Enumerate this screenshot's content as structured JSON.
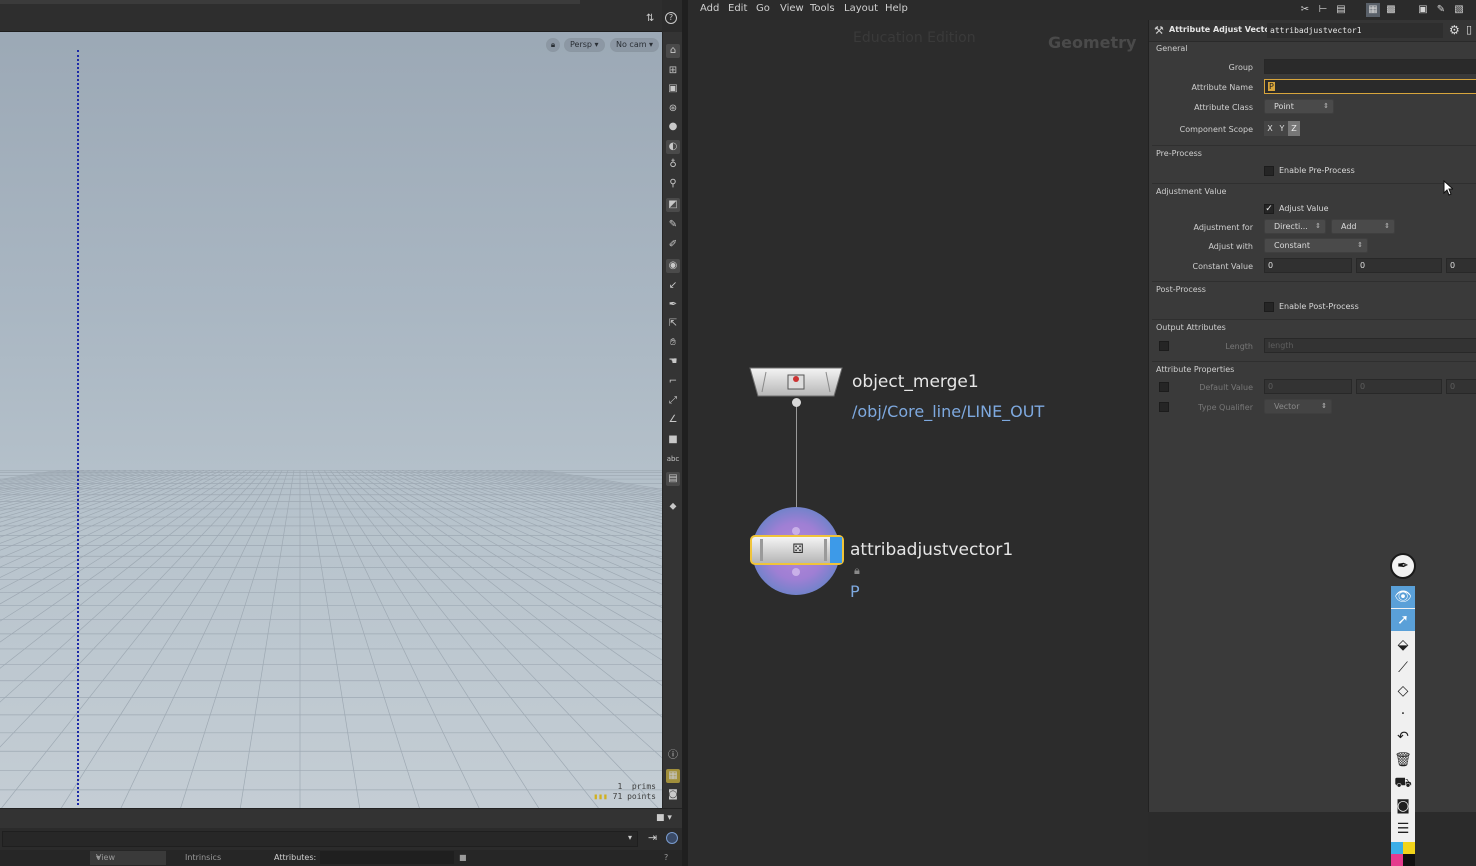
{
  "viewport": {
    "persp_label": "Persp",
    "cam_label": "No cam",
    "stats": {
      "prims_count": "1",
      "prims_label": "prims",
      "points_count": "71",
      "points_label": "points"
    }
  },
  "bottom_bar": {
    "view_tab": "View",
    "intrinsics_tab": "Intrinsics",
    "attributes_label": "Attributes:"
  },
  "menubar": {
    "items": [
      "Add",
      "Edit",
      "Go",
      "View",
      "Tools",
      "Layout",
      "Help"
    ]
  },
  "network": {
    "watermark_edition": "Education Edition",
    "context_label": "Geometry",
    "nodes": [
      {
        "name": "object_merge1",
        "subtitle": "/obj/Core_line/LINE_OUT"
      },
      {
        "name": "attribadjustvector1",
        "subtitle": "P"
      }
    ]
  },
  "params": {
    "node_type": "Attribute Adjust Vector",
    "node_name": "attribadjustvector1",
    "sections": {
      "general": "General",
      "preprocess": "Pre-Process",
      "adjustment": "Adjustment Value",
      "postprocess": "Post-Process",
      "output": "Output Attributes",
      "attrprops": "Attribute Properties"
    },
    "group_label": "Group",
    "group_value": "",
    "attr_name_label": "Attribute Name",
    "attr_name_value": "P",
    "attr_class_label": "Attribute Class",
    "attr_class_value": "Point",
    "component_scope_label": "Component Scope",
    "component_scope": [
      "X",
      "Y",
      "Z"
    ],
    "enable_preprocess": "Enable Pre-Process",
    "adjust_value_label": "Adjust Value",
    "adjust_value_checked": true,
    "adjustment_for_label": "Adjustment for",
    "adjustment_for_value": "Directi...",
    "adjustment_op_value": "Add",
    "adjust_with_label": "Adjust with",
    "adjust_with_value": "Constant",
    "constant_value_label": "Constant Value",
    "constant_values": [
      "0",
      "0",
      "0"
    ],
    "enable_postprocess": "Enable Post-Process",
    "length_label": "Length",
    "length_placeholder": "length",
    "default_value_label": "Default Value",
    "default_values": [
      "0",
      "0",
      "0"
    ],
    "type_qualifier_label": "Type Qualifier",
    "type_qualifier_value": "Vector"
  }
}
